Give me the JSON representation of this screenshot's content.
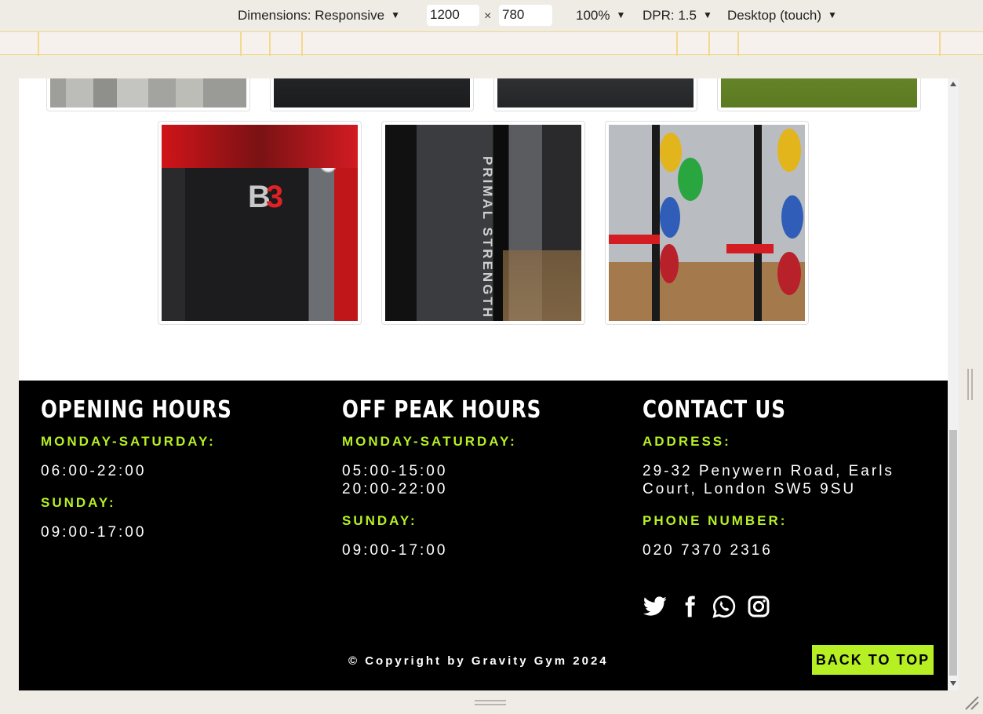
{
  "devtools": {
    "dimensions_label": "Dimensions: Responsive",
    "width_value": "1200",
    "times_symbol": "×",
    "height_value": "780",
    "zoom": "100%",
    "dpr": "DPR: 1.5",
    "device_mode": "Desktop (touch)"
  },
  "gallery": {
    "images": [
      {
        "name": "gym-floor-photo"
      },
      {
        "name": "gym-mat-photo"
      },
      {
        "name": "gym-bench-photo"
      },
      {
        "name": "gym-turf-photo"
      },
      {
        "name": "b3-punchbag-photo",
        "overlay_text": "B3"
      },
      {
        "name": "primal-strength-rack-photo",
        "overlay_text": "PRIMAL STRENGTH"
      },
      {
        "name": "squat-rack-plates-photo"
      }
    ]
  },
  "footer": {
    "opening_hours": {
      "title": "OPENING HOURS",
      "weekday_label": "MONDAY-SATURDAY:",
      "weekday_hours": "06:00-22:00",
      "sunday_label": "SUNDAY:",
      "sunday_hours": "09:00-17:00"
    },
    "off_peak": {
      "title": "OFF PEAK HOURS",
      "weekday_label": "MONDAY-SATURDAY:",
      "weekday_hours_1": "05:00-15:00",
      "weekday_hours_2": "20:00-22:00",
      "sunday_label": "SUNDAY:",
      "sunday_hours": "09:00-17:00"
    },
    "contact": {
      "title": "CONTACT US",
      "address_label": "ADDRESS:",
      "address_line_1": "29-32 Penywern Road, Earls",
      "address_line_2": "Court, London SW5 9SU",
      "phone_label": "PHONE NUMBER:",
      "phone": "020 7370 2316"
    },
    "social_icons": [
      "twitter-icon",
      "facebook-icon",
      "whatsapp-icon",
      "instagram-icon"
    ],
    "copyright": "© Copyright by Gravity Gym 2024",
    "back_to_top": "BACK TO TOP"
  },
  "colors": {
    "accent": "#b6f024",
    "footer_bg": "#000000",
    "text": "#ffffff"
  }
}
